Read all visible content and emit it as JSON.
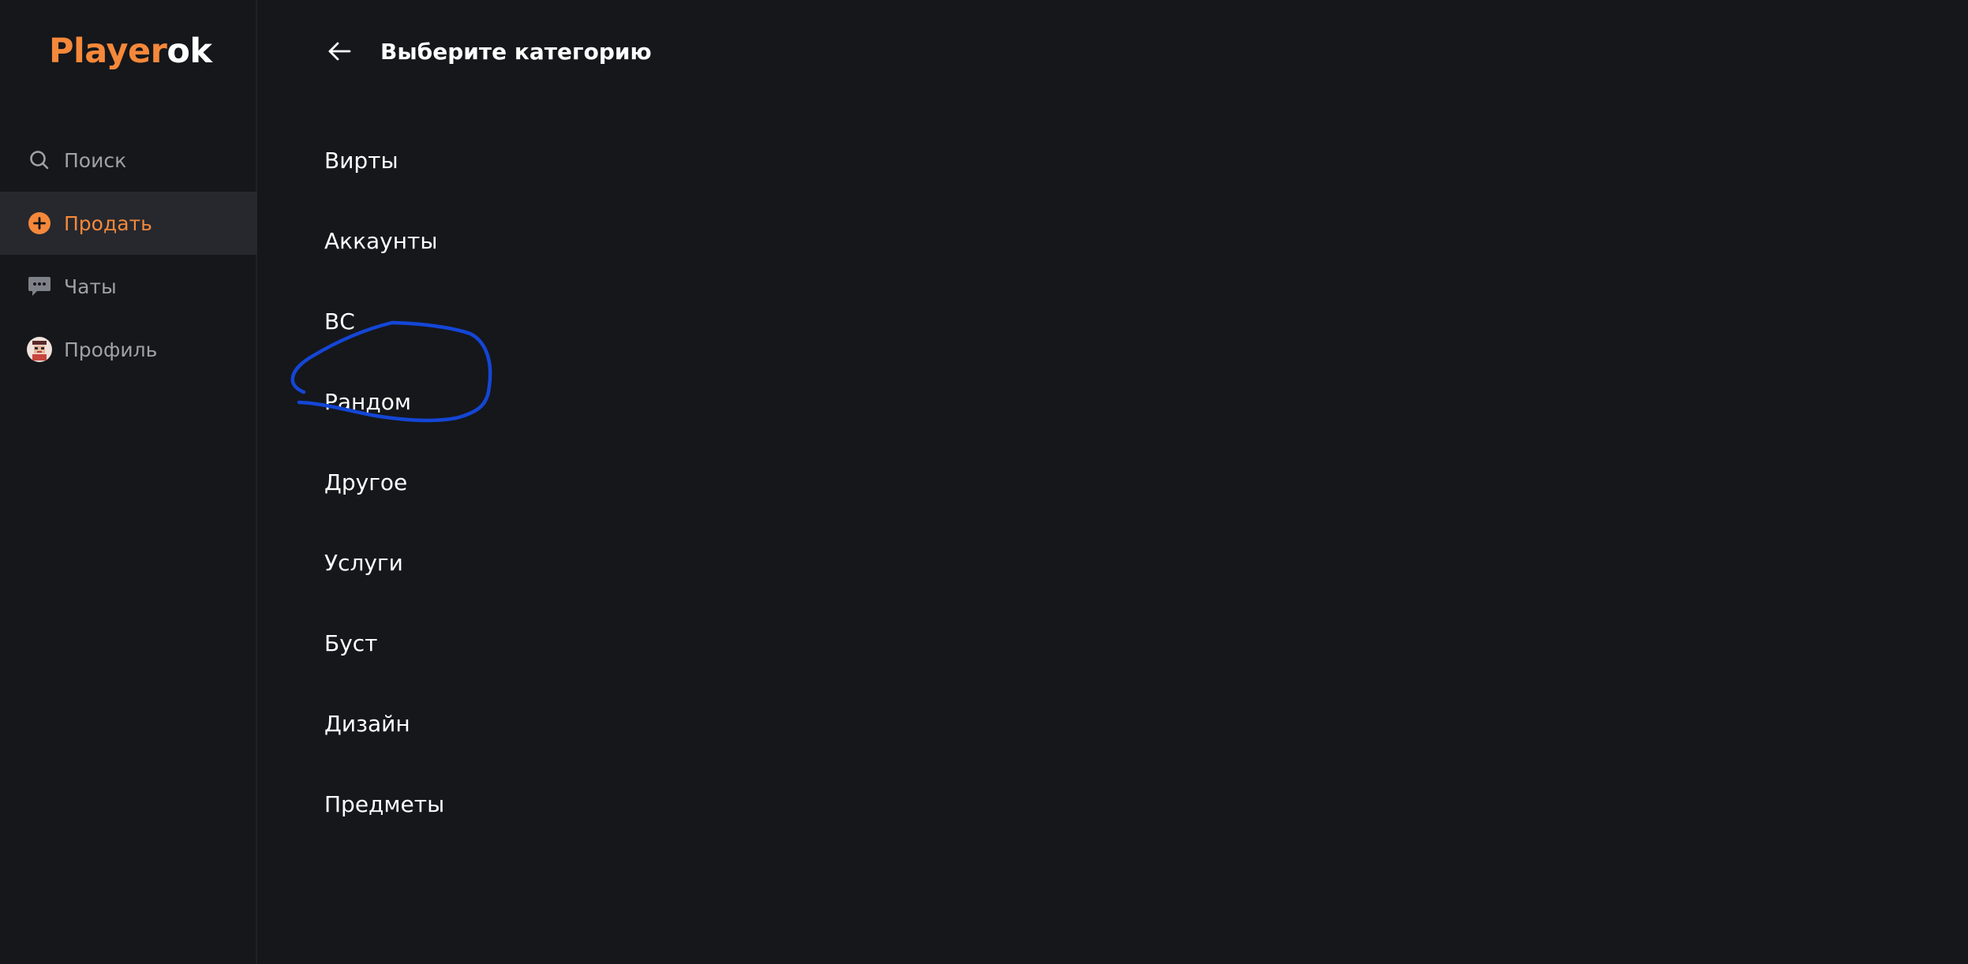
{
  "brand": {
    "part1": "Player",
    "part2": "ok",
    "accent_color": "#f5883a"
  },
  "sidebar": {
    "items": [
      {
        "label": "Поиск",
        "icon": "search-icon"
      },
      {
        "label": "Продать",
        "icon": "plus-circle-icon",
        "active": true
      },
      {
        "label": "Чаты",
        "icon": "chat-icon"
      },
      {
        "label": "Профиль",
        "icon": "avatar-icon"
      }
    ]
  },
  "main": {
    "title": "Выберите категорию",
    "categories": [
      "Вирты",
      "Аккаунты",
      "ВС",
      "Рандом",
      "Другое",
      "Услуги",
      "Буст",
      "Дизайн",
      "Предметы"
    ]
  },
  "annotation": {
    "color": "#1446d6",
    "circled_item": "Рандом"
  }
}
